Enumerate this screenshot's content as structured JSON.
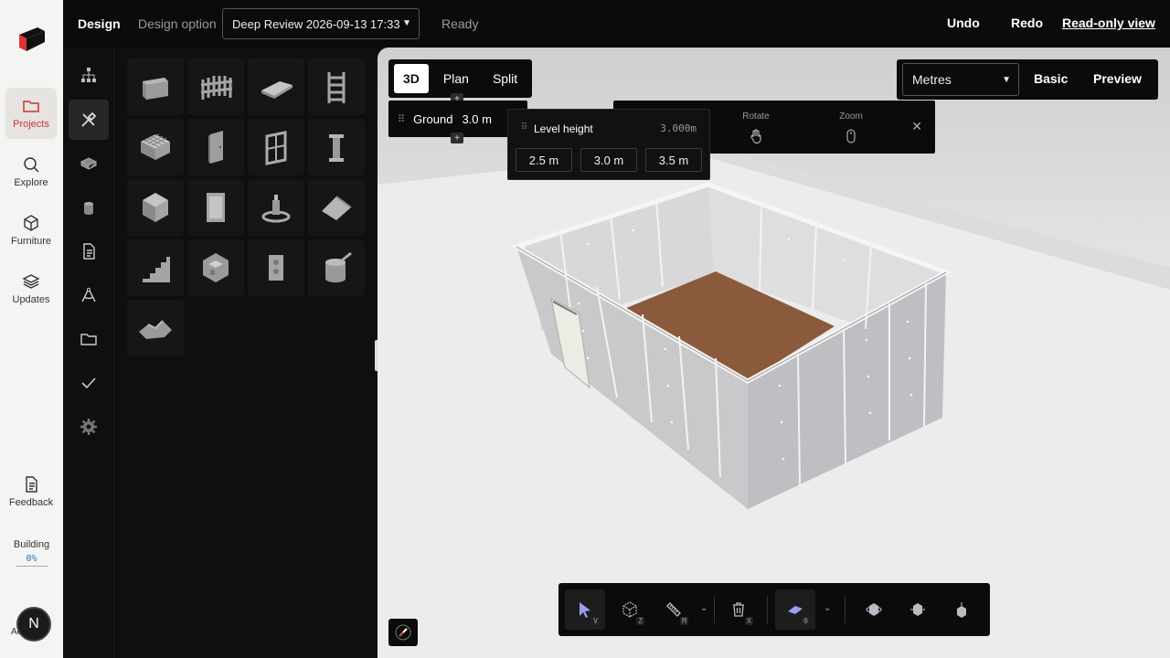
{
  "rail": {
    "items": [
      {
        "label": "Projects",
        "icon": "folder-icon"
      },
      {
        "label": "Explore",
        "icon": "search-icon"
      },
      {
        "label": "Furniture",
        "icon": "box-icon"
      },
      {
        "label": "Updates",
        "icon": "layers-icon"
      },
      {
        "label": "Feedback",
        "icon": "document-icon"
      }
    ],
    "status_label": "Building",
    "status_pct": "0%",
    "avatar_initial": "N",
    "avatar_under": "Account"
  },
  "topbar": {
    "title": "Design",
    "option_label": "Design option",
    "option_value": "Deep Review 2026-09-13 17:33",
    "status": "Ready",
    "undo": "Undo",
    "redo": "Redo",
    "readonly": "Read-only view"
  },
  "viewport": {
    "tabs": [
      "3D",
      "Plan",
      "Split"
    ],
    "active_tab": "3D",
    "level_name": "Ground",
    "level_height": "3.0 m",
    "help": {
      "rotate": "Rotate",
      "zoom": "Zoom"
    },
    "level_popup": {
      "title": "Level height",
      "value": "3.000m",
      "options": [
        "2.5 m",
        "3.0 m",
        "3.5 m"
      ]
    },
    "units": {
      "value": "Metres",
      "basic": "Basic",
      "preview": "Preview"
    }
  },
  "bottombar": {
    "tools": [
      {
        "icon": "pointer-icon",
        "key": "V"
      },
      {
        "icon": "cube-select-icon",
        "key": "Z"
      },
      {
        "icon": "measure-icon",
        "key": "M"
      },
      {
        "icon": "trash-icon",
        "key": "X"
      },
      {
        "icon": "floor-icon",
        "key": "0"
      }
    ]
  },
  "colors": {
    "accent": "#c0392b",
    "floor": "#8b5a3c",
    "wall": "#c9c9cc"
  }
}
